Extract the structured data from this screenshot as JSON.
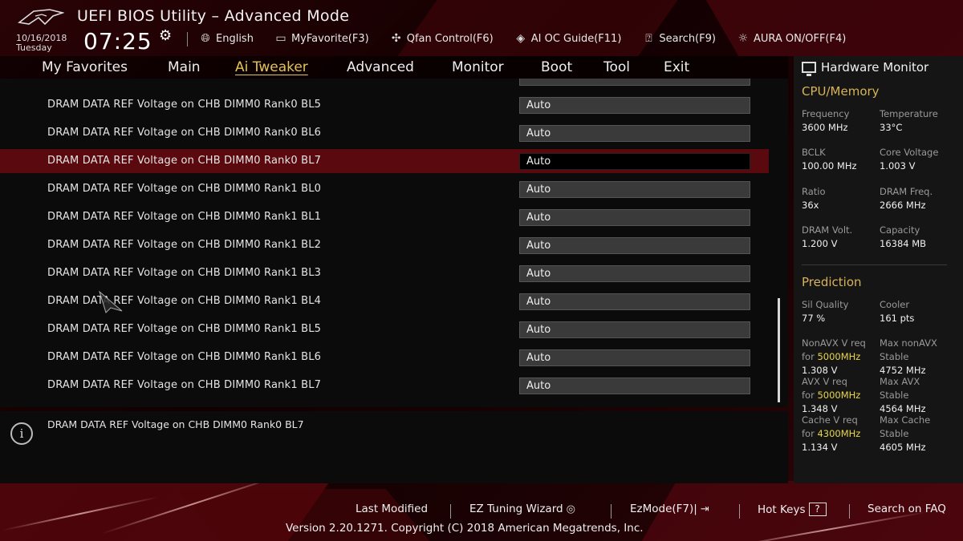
{
  "app": {
    "title": "UEFI BIOS Utility – Advanced Mode",
    "date": "10/16/2018",
    "day": "Tuesday",
    "time": "07:25"
  },
  "toolbar": {
    "items": [
      {
        "label": "English",
        "icon": "globe-icon"
      },
      {
        "label": "MyFavorite(F3)",
        "icon": "favorite-icon"
      },
      {
        "label": "Qfan Control(F6)",
        "icon": "fan-icon"
      },
      {
        "label": "AI OC Guide(F11)",
        "icon": "ai-oc-icon"
      },
      {
        "label": "Search(F9)",
        "icon": "search-help-icon"
      },
      {
        "label": "AURA ON/OFF(F4)",
        "icon": "aura-icon"
      }
    ]
  },
  "nav": {
    "tabs": [
      "My Favorites",
      "Main",
      "Ai Tweaker",
      "Advanced",
      "Monitor",
      "Boot",
      "Tool",
      "Exit"
    ],
    "active": "Ai Tweaker"
  },
  "settings": {
    "rows": [
      {
        "label": "DRAM DATA REF Voltage on CHB DIMM0 Rank0 BL5",
        "value": "Auto"
      },
      {
        "label": "DRAM DATA REF Voltage on CHB DIMM0 Rank0 BL6",
        "value": "Auto"
      },
      {
        "label": "DRAM DATA REF Voltage on CHB DIMM0 Rank0 BL7",
        "value": "Auto"
      },
      {
        "label": "DRAM DATA REF Voltage on CHB DIMM0 Rank1 BL0",
        "value": "Auto"
      },
      {
        "label": "DRAM DATA REF Voltage on CHB DIMM0 Rank1 BL1",
        "value": "Auto"
      },
      {
        "label": "DRAM DATA REF Voltage on CHB DIMM0 Rank1 BL2",
        "value": "Auto"
      },
      {
        "label": "DRAM DATA REF Voltage on CHB DIMM0 Rank1 BL3",
        "value": "Auto"
      },
      {
        "label": "DRAM DATA REF Voltage on CHB DIMM0 Rank1 BL4",
        "value": "Auto"
      },
      {
        "label": "DRAM DATA REF Voltage on CHB DIMM0 Rank1 BL5",
        "value": "Auto"
      },
      {
        "label": "DRAM DATA REF Voltage on CHB DIMM0 Rank1 BL6",
        "value": "Auto"
      },
      {
        "label": "DRAM DATA REF Voltage on CHB DIMM0 Rank1 BL7",
        "value": "Auto"
      }
    ],
    "selected_index": 2
  },
  "info": {
    "text": "DRAM DATA REF Voltage on CHB DIMM0 Rank0 BL7"
  },
  "hardware_monitor": {
    "title": "Hardware Monitor",
    "cpu_memory": {
      "heading": "CPU/Memory",
      "frequency_label": "Frequency",
      "frequency": "3600 MHz",
      "temperature_label": "Temperature",
      "temperature": "33°C",
      "bclk_label": "BCLK",
      "bclk": "100.00 MHz",
      "core_voltage_label": "Core Voltage",
      "core_voltage": "1.003 V",
      "ratio_label": "Ratio",
      "ratio": "36x",
      "dram_freq_label": "DRAM Freq.",
      "dram_freq": "2666 MHz",
      "dram_volt_label": "DRAM Volt.",
      "dram_volt": "1.200 V",
      "capacity_label": "Capacity",
      "capacity": "16384 MB"
    },
    "prediction": {
      "heading": "Prediction",
      "sil_quality_label": "Sil Quality",
      "sil_quality": "77 %",
      "cooler_label": "Cooler",
      "cooler": "161 pts",
      "nonavx_label": "NonAVX V req",
      "for_label": "for",
      "nonavx_freq": "5000MHz",
      "nonavx_v": "1.308 V",
      "max_nonavx_label": "Max nonAVX",
      "stable_label": "Stable",
      "max_nonavx": "4752 MHz",
      "avx_label": "AVX V req",
      "avx_freq": "5000MHz",
      "avx_v": "1.348 V",
      "max_avx_label": "Max AVX",
      "max_avx": "4564 MHz",
      "cache_label": "Cache V req",
      "cache_freq": "4300MHz",
      "cache_v": "1.134 V",
      "max_cache_label": "Max Cache",
      "max_cache": "4605 MHz"
    }
  },
  "footer": {
    "last_modified": "Last Modified",
    "ez_tuning": "EZ Tuning Wizard",
    "ez_mode": "EzMode(F7)|",
    "hot_keys": "Hot Keys",
    "hot_keys_key": "?",
    "search_faq": "Search on FAQ",
    "version": "Version 2.20.1271. Copyright (C) 2018 American Megatrends, Inc."
  },
  "colors": {
    "accent_gold": "#d7b35a",
    "highlight_yellow": "#e8d54a",
    "selected_row": "#5a0a0e",
    "brand_red": "#7a0a12"
  }
}
